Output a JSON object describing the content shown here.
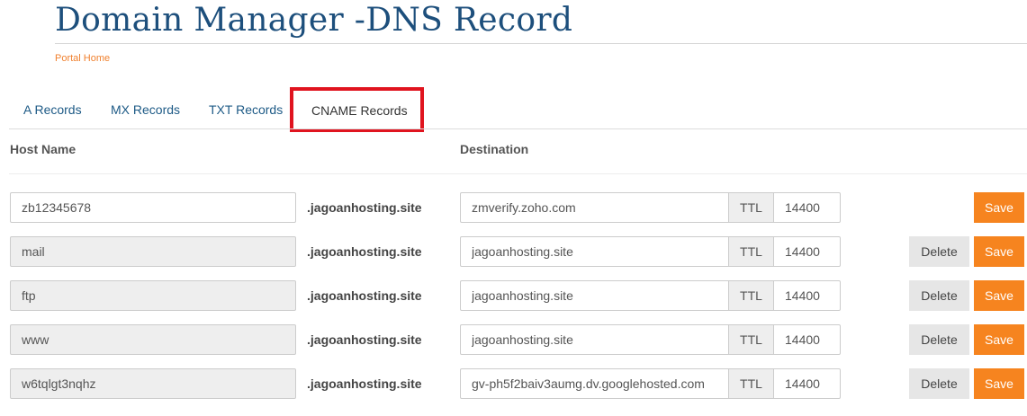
{
  "page": {
    "title": "Domain Manager -DNS Record",
    "breadcrumb": "Portal Home"
  },
  "tabs": [
    {
      "label": "A Records",
      "active": false
    },
    {
      "label": "MX Records",
      "active": false
    },
    {
      "label": "TXT Records",
      "active": false
    },
    {
      "label": "CNAME Records",
      "active": true
    }
  ],
  "colors": {
    "title": "#1d4f7c",
    "breadcrumb": "#f0812f",
    "highlight_box": "#e0141f",
    "save_button": "#f6841f",
    "delete_button": "#e6e6e6"
  },
  "table": {
    "headers": {
      "host": "Host Name",
      "destination": "Destination"
    },
    "ttl_label": "TTL",
    "delete_label": "Delete",
    "save_label": "Save",
    "rows": [
      {
        "host": "zb12345678",
        "suffix": ".jagoanhosting.site",
        "destination": "zmverify.zoho.com",
        "ttl": "14400",
        "host_readonly": false,
        "show_delete": false
      },
      {
        "host": "mail",
        "suffix": ".jagoanhosting.site",
        "destination": "jagoanhosting.site",
        "ttl": "14400",
        "host_readonly": true,
        "show_delete": true
      },
      {
        "host": "ftp",
        "suffix": ".jagoanhosting.site",
        "destination": "jagoanhosting.site",
        "ttl": "14400",
        "host_readonly": true,
        "show_delete": true
      },
      {
        "host": "www",
        "suffix": ".jagoanhosting.site",
        "destination": "jagoanhosting.site",
        "ttl": "14400",
        "host_readonly": true,
        "show_delete": true
      },
      {
        "host": "w6tqlgt3nqhz",
        "suffix": ".jagoanhosting.site",
        "destination": "gv-ph5f2baiv3aumg.dv.googlehosted.com",
        "ttl": "14400",
        "host_readonly": true,
        "show_delete": true
      }
    ]
  }
}
